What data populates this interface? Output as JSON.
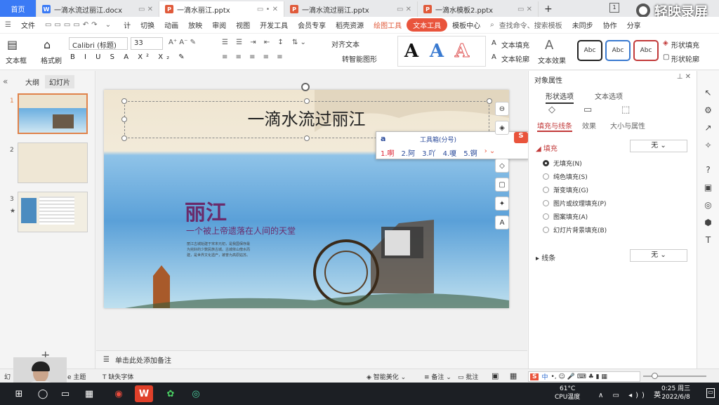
{
  "tabs": {
    "home": "首页",
    "items": [
      {
        "label": "一滴水流过丽江.docx",
        "kind": "W",
        "color": "#3a7af5"
      },
      {
        "label": "一滴水丽江.pptx",
        "kind": "P",
        "color": "#e05a3a"
      },
      {
        "label": "一滴水流过丽江.pptx",
        "kind": "P",
        "color": "#e05a3a"
      },
      {
        "label": "一滴水模板2.pptx",
        "kind": "P",
        "color": "#e05a3a"
      }
    ],
    "new_tab": "+",
    "badge": "1",
    "recorder": "轻映录屏"
  },
  "menu": {
    "file": "文件",
    "items": [
      "计",
      "切换",
      "动画",
      "放映",
      "审阅",
      "视图",
      "开发工具",
      "会员专享",
      "稻壳资源"
    ],
    "drawing_tools": "绘图工具",
    "text_tools": "文本工具",
    "template_center": "模板中心",
    "search": "查找命令、搜索模板",
    "unsynced": "未同步",
    "collab": "协作",
    "share": "分享"
  },
  "toolbar": {
    "textbox": "文本框",
    "format_brush": "格式刷",
    "font": "Calibri (标题)",
    "size": "33",
    "align_text": "对齐文本",
    "smart_shape": "转智能图形",
    "text_fill": "文本填充",
    "text_outline": "文本轮廓",
    "text_effect": "文本效果",
    "shape_fill": "形状填充",
    "shape_outline": "形状轮廓",
    "style_abc": "Abc",
    "big_a": "A",
    "colors": {
      "a1": "#111111",
      "a2": "#3a7ad0",
      "a3": "#e05a5a",
      "abc1": "#222222",
      "abc2": "#3a7ad0",
      "abc3": "#c23a3a"
    }
  },
  "left_panel": {
    "outline_tab": "大纲",
    "slides_tab": "幻灯片",
    "slides": [
      "1",
      "2",
      "3"
    ],
    "star": "★"
  },
  "slide": {
    "title": "一滴水流过丽江",
    "lijiang": "丽江",
    "slogan": "一个被上帝遗落在人间的天堂",
    "para": "丽江古城始建于宋末元初，是我国保存最为完好的少数民族古城。古城依山傍水而建，是世界文化遗产，被誉为高原姑苏。"
  },
  "ime": {
    "input": "a",
    "toolbox": "工具箱(分号)",
    "candidates": [
      "1.啊",
      "2.阿",
      "3.吖",
      "4.嗄",
      "5.锕"
    ]
  },
  "notes": {
    "placeholder": "单击此处添加备注"
  },
  "right_panel": {
    "title": "对象属性",
    "tab_shape": "形状选项",
    "tab_text": "文本选项",
    "sub_fill_line": "填充与线条",
    "sub_effect": "效果",
    "sub_size": "大小与属性",
    "fill_label": "填充",
    "fill_value": "无",
    "fill_options": [
      "无填充(N)",
      "纯色填充(S)",
      "渐变填充(G)",
      "图片或纹理填充(P)",
      "图案填充(A)",
      "幻灯片背景填充(B)"
    ],
    "line_label": "线条",
    "line_value": "无"
  },
  "status": {
    "slide_info": "幻",
    "theme": "e 主题",
    "missing_font": "缺失字体",
    "smart_beautify": "智能美化",
    "notes_btn": "备注",
    "comment_btn": "批注"
  },
  "taskbar": {
    "temp": "61°C",
    "cpu": "CPU温度",
    "time": "0:25 周三",
    "date": "2022/6/8",
    "ime": "中",
    "wps_label": "W"
  }
}
